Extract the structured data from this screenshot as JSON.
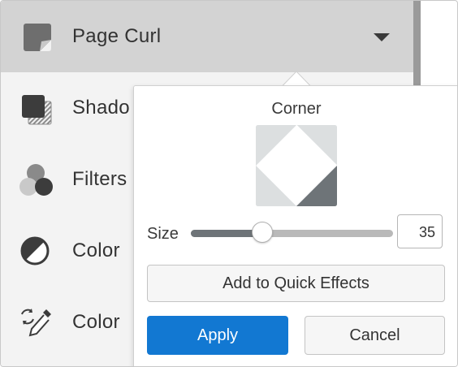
{
  "menu": {
    "items": [
      {
        "label": "Page Curl",
        "icon": "page-curl-icon",
        "selected": true
      },
      {
        "label": "Shado",
        "icon": "shadow-icon"
      },
      {
        "label": "Filters",
        "icon": "filters-icon"
      },
      {
        "label": "Color",
        "icon": "color-adjust-icon"
      },
      {
        "label": "Color",
        "icon": "color-replace-icon"
      }
    ]
  },
  "popover": {
    "corner_title": "Corner",
    "selected_corner": "bottom-right",
    "size_label": "Size",
    "size_value": "35",
    "slider_fraction": 0.35,
    "quick_effects_label": "Add to Quick Effects",
    "apply_label": "Apply",
    "cancel_label": "Cancel"
  },
  "colors": {
    "accent": "#1278d2",
    "selected_row": "#d3d3d3",
    "corner_selected": "#6e7478",
    "corner_unselected": "#dcdfe0"
  }
}
